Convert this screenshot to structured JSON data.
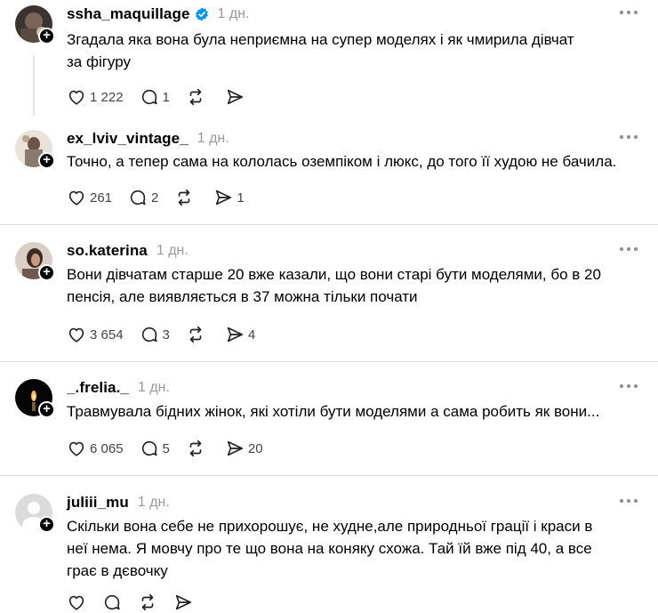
{
  "posts": [
    {
      "username": "ssha_maquillage",
      "verified": true,
      "time": "1 дн.",
      "lines": [
        "Згадала яка вона була неприємна на супер моделях і як чмирила дівчат",
        "за фігуру"
      ],
      "likes": "1 222",
      "replies": "1",
      "reposts": "",
      "shares": ""
    },
    {
      "username": "ex_lviv_vintage_",
      "verified": false,
      "time": "1 дн.",
      "lines": [
        "Точно, а тепер сама на кололась оземпіком і люкс, до того її худою не бачила."
      ],
      "likes": "261",
      "replies": "2",
      "reposts": "",
      "shares": "1"
    },
    {
      "username": "so.katerina",
      "verified": false,
      "time": "1 дн.",
      "lines": [
        "Вони дівчатам старше 20 вже казали, що вони старі бути моделями, бо в 20",
        "пенсія, але виявляється в 37 можна тільки почати"
      ],
      "likes": "3 654",
      "replies": "3",
      "reposts": "",
      "shares": "4"
    },
    {
      "username": "_.frelia._",
      "verified": false,
      "time": "1 дн.",
      "lines": [
        "Травмувала бідних жінок, які хотіли бути моделями а сама робить як вони..."
      ],
      "likes": "6 065",
      "replies": "5",
      "reposts": "",
      "shares": "20"
    },
    {
      "username": "juliii_mu",
      "verified": false,
      "time": "1 дн.",
      "lines": [
        "Скільки вона себе не прихорошує, не худне,але природньої грації і краси в",
        "неї нема. Я мовчу про те що вона на коняку схожа. Тай їй вже під 40, а все",
        "грає в дєвочку"
      ],
      "likes": "",
      "replies": "",
      "reposts": "",
      "shares": ""
    }
  ],
  "colors": {
    "verified": "#0095f6",
    "muted": "#999999",
    "divider": "#dbdbdb"
  }
}
